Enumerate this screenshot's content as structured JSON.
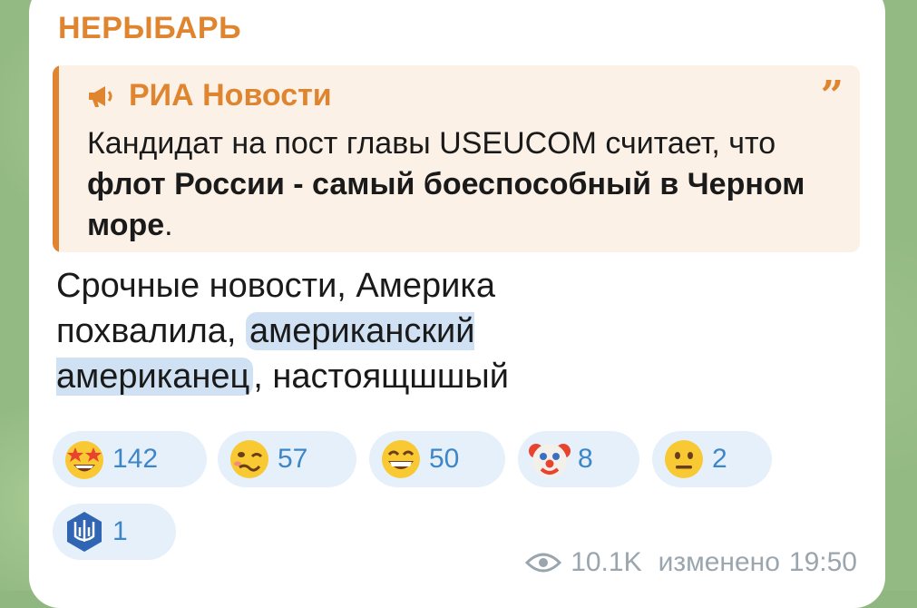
{
  "post": {
    "channel_name": "НЕРЫБАРЬ",
    "forward": {
      "source": "РИА Новости",
      "text_plain_1": "Кандидат на пост главы USEUCOM считает, что ",
      "text_bold": "флот России - самый боеспособный в Черном море",
      "text_plain_2": "."
    },
    "message": {
      "part1": "Срочные новости, Америка похвалила",
      "comma1": ", ",
      "highlight1": "американский американец",
      "comma2": ", ",
      "part2": "настоящшшый"
    },
    "reactions": [
      {
        "icon": "star-struck-emoji-icon",
        "count": "142"
      },
      {
        "icon": "woozy-face-emoji-icon",
        "count": "57"
      },
      {
        "icon": "grinning-face-emoji-icon",
        "count": "50"
      },
      {
        "icon": "clown-face-emoji-icon",
        "count": "8"
      },
      {
        "icon": "neutral-face-emoji-icon",
        "count": "2"
      },
      {
        "icon": "ukraine-trident-emoji-icon",
        "count": "1"
      }
    ],
    "footer": {
      "views": "10.1K",
      "edited_label": "изменено",
      "time": "19:50"
    }
  },
  "colors": {
    "accent": "#e0852f",
    "reaction_bg": "#e5f0fa",
    "reaction_text": "#3d86c7",
    "highlight": "#cfe1f3",
    "meta_text": "#9aa5ae"
  }
}
